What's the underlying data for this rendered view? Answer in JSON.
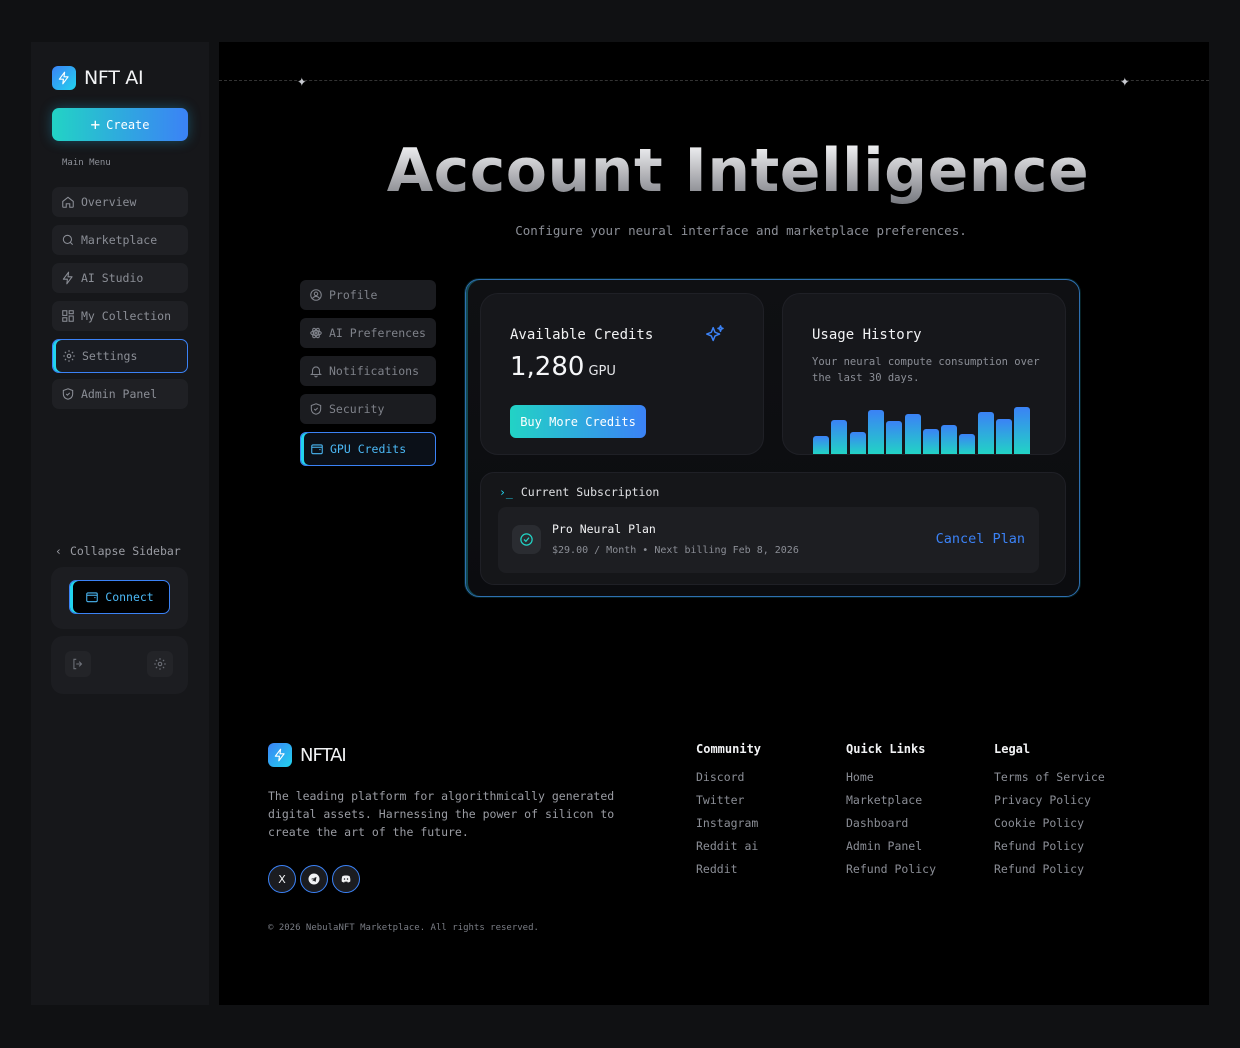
{
  "colors": {
    "accent_blue": "#3b82f6",
    "accent_cyan": "#22d3ee",
    "background": "#000000",
    "sidebar_bg": "#16171a"
  },
  "sidebar": {
    "brand": "NFT AI",
    "create_label": "Create",
    "section_label": "Main Menu",
    "items": [
      {
        "label": "Overview",
        "icon": "home-icon"
      },
      {
        "label": "Marketplace",
        "icon": "search-icon"
      },
      {
        "label": "AI Studio",
        "icon": "bolt-icon"
      },
      {
        "label": "My Collection",
        "icon": "grid-icon"
      },
      {
        "label": "Settings",
        "icon": "gear-icon",
        "active": true
      },
      {
        "label": "Admin Panel",
        "icon": "shield-icon"
      }
    ],
    "collapse_label": "Collapse Sidebar",
    "connect_label": "Connect"
  },
  "header": {
    "title": "Account Intelligence",
    "subtitle": "Configure your neural interface and marketplace preferences."
  },
  "settings_tabs": [
    {
      "label": "Profile",
      "icon": "user-icon"
    },
    {
      "label": "AI Preferences",
      "icon": "atom-icon"
    },
    {
      "label": "Notifications",
      "icon": "bell-icon"
    },
    {
      "label": "Security",
      "icon": "shield-icon"
    },
    {
      "label": "GPU Credits",
      "icon": "wallet-icon",
      "active": true
    }
  ],
  "credits": {
    "title": "Available Credits",
    "amount": "1,280",
    "unit": "GPU",
    "buy_label": "Buy More Credits"
  },
  "usage": {
    "title": "Usage History",
    "description": "Your neural compute consumption over the last 30 days.",
    "bars": [
      0.3,
      0.57,
      0.37,
      0.74,
      0.55,
      0.66,
      0.41,
      0.48,
      0.33,
      0.7,
      0.59,
      0.78
    ]
  },
  "subscription": {
    "section_title": "Current Subscription",
    "plan_name": "Pro Neural Plan",
    "plan_meta": "$29.00 / Month • Next billing Feb 8, 2026",
    "cancel_label": "Cancel Plan"
  },
  "footer": {
    "brand": "NFTAI",
    "description": "The leading platform for algorithmically generated digital assets. Harnessing the power of silicon to create the art of the future.",
    "socials": [
      {
        "icon": "x-icon",
        "glyph": "X"
      },
      {
        "icon": "telegram-icon",
        "glyph": ""
      },
      {
        "icon": "discord-icon",
        "glyph": ""
      }
    ],
    "copyright": "© 2026 NebulaNFT Marketplace. All rights reserved.",
    "columns": [
      {
        "title": "Community",
        "links": [
          "Discord",
          "Twitter",
          "Instagram",
          "Reddit ai",
          "Reddit"
        ]
      },
      {
        "title": "Quick Links",
        "links": [
          "Home",
          "Marketplace",
          "Dashboard",
          "Admin Panel",
          "Refund Policy"
        ]
      },
      {
        "title": "Legal",
        "links": [
          "Terms of Service",
          "Privacy Policy",
          "Cookie Policy",
          "Refund Policy",
          "Refund Policy"
        ]
      }
    ]
  }
}
